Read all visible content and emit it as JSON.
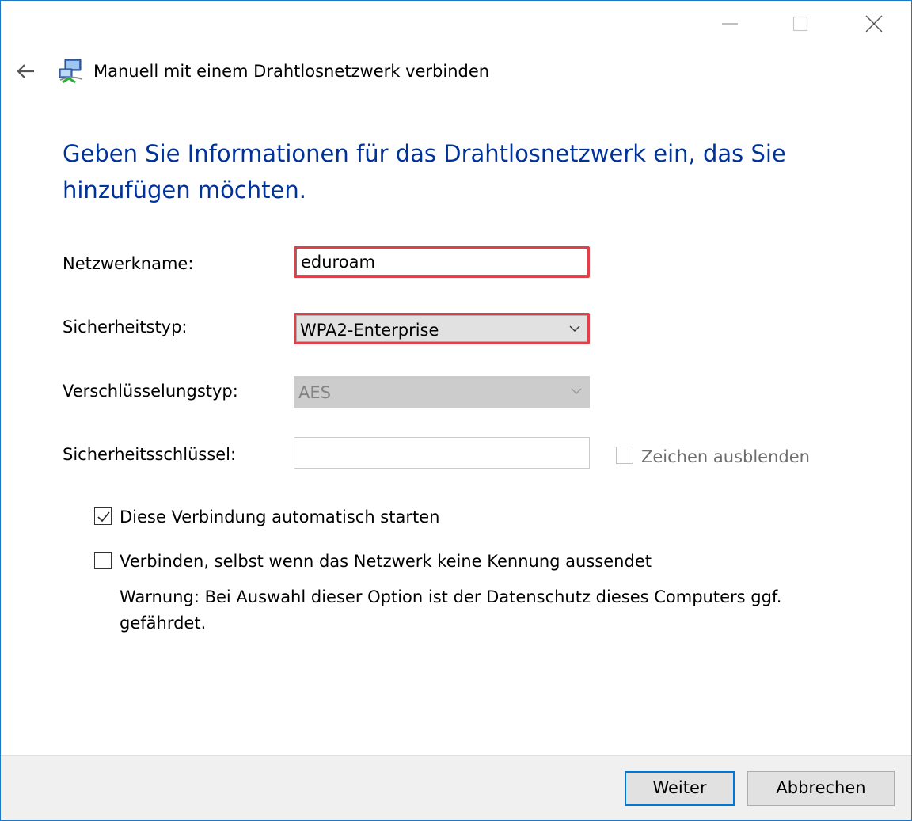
{
  "window": {
    "controls": {
      "minimize_icon": "minimize-icon",
      "maximize_icon": "maximize-icon",
      "close_icon": "close-icon"
    }
  },
  "header": {
    "back_icon": "back-arrow-icon",
    "network_icon": "network-wizard-icon",
    "title": "Manuell mit einem Drahtlosnetzwerk verbinden"
  },
  "main": {
    "instruction": "Geben Sie Informationen für das Drahtlosnetzwerk ein, das Sie hinzufügen möchten.",
    "network_name": {
      "label": "Netzwerkname:",
      "value": "eduroam"
    },
    "security_type": {
      "label": "Sicherheitstyp:",
      "selected": "WPA2-Enterprise"
    },
    "encryption_type": {
      "label": "Verschlüsselungstyp:",
      "selected": "AES",
      "disabled": true
    },
    "security_key": {
      "label": "Sicherheitsschlüssel:",
      "value": "",
      "hide_characters": {
        "label": "Zeichen ausblenden",
        "checked": false,
        "disabled": true
      }
    },
    "auto_start": {
      "label": "Diese Verbindung automatisch starten",
      "checked": true
    },
    "connect_hidden": {
      "label": "Verbinden, selbst wenn das Netzwerk keine Kennung aussendet",
      "checked": false
    },
    "warning": "Warnung: Bei Auswahl dieser Option ist der Datenschutz dieses Computers ggf. gefährdet."
  },
  "footer": {
    "next_label": "Weiter",
    "cancel_label": "Abbrechen"
  },
  "colors": {
    "instruction_text": "#003399",
    "highlight_border": "#e0404a",
    "default_button_border": "#0078d7",
    "window_border": "#1e78c8"
  }
}
